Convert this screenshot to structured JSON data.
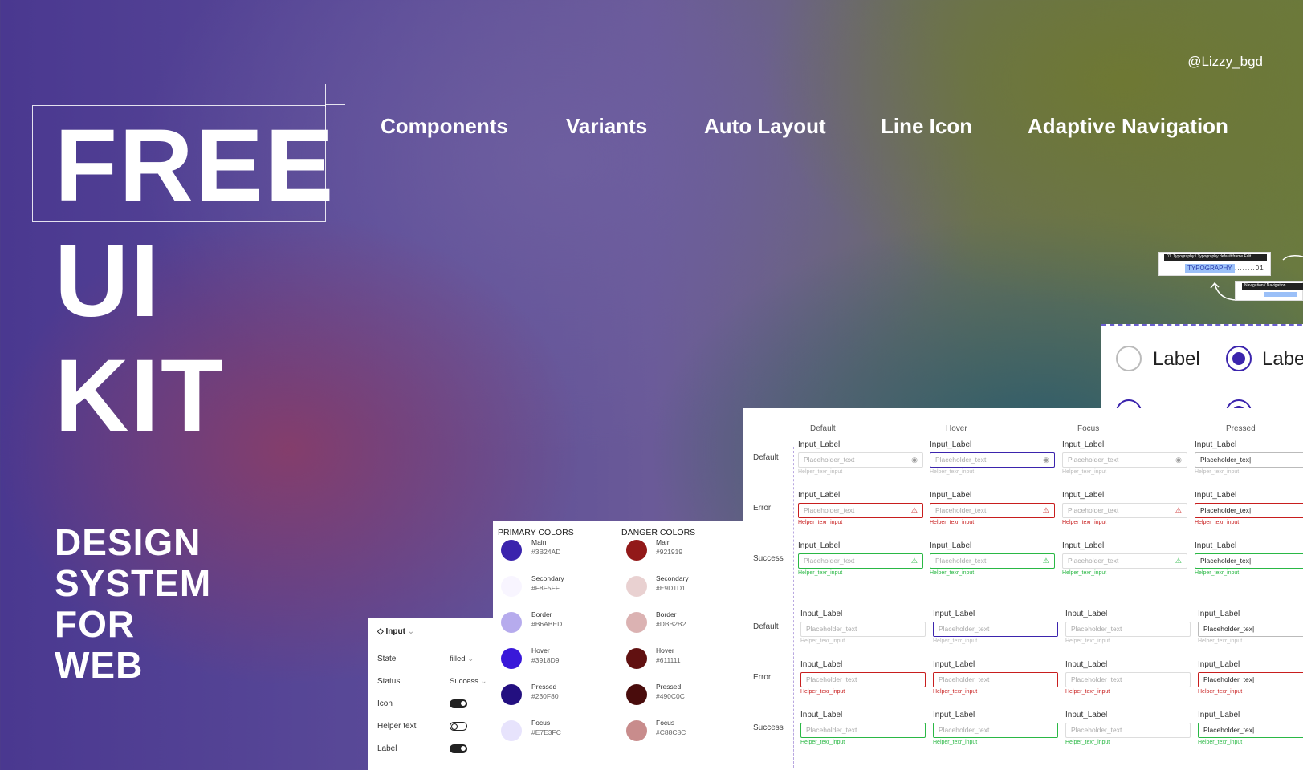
{
  "handle": "@Lizzy_bgd",
  "nav": [
    "Components",
    "Variants",
    "Auto Layout",
    "Line Icon",
    "Adaptive Navigation"
  ],
  "hero": {
    "line1": "FREE",
    "line2": "UI",
    "line3": "KIT"
  },
  "subtitle": [
    "DESIGN",
    "SYSTEM",
    "FOR",
    "WEB"
  ],
  "typography_chip": {
    "header": "01. Typography / Typography  default frame  Edit",
    "tag": "TYPOGRAPHY",
    "dots": "........01"
  },
  "navigation_chip": {
    "header": "Navigation / Navigation"
  },
  "radio": {
    "label": "Label"
  },
  "input_panel": {
    "title": "Input",
    "rows": [
      {
        "label": "State",
        "value": "filled",
        "type": "select"
      },
      {
        "label": "Status",
        "value": "Success",
        "type": "select"
      },
      {
        "label": "Icon",
        "type": "toggle",
        "on": true
      },
      {
        "label": "Helper text",
        "type": "toggle",
        "on": false
      },
      {
        "label": "Label",
        "type": "toggle",
        "on": true
      }
    ]
  },
  "colors": {
    "primary_title": "PRIMARY COLORS",
    "danger_title": "DANGER COLORS",
    "primary": [
      {
        "name": "Main",
        "hex": "#3B24AD"
      },
      {
        "name": "Secondary",
        "hex": "#F8F5FF"
      },
      {
        "name": "Border",
        "hex": "#B6ABED"
      },
      {
        "name": "Hover",
        "hex": "#3918D9"
      },
      {
        "name": "Pressed",
        "hex": "#230F80"
      },
      {
        "name": "Focus",
        "hex": "#E7E3FC"
      }
    ],
    "danger": [
      {
        "name": "Main",
        "hex": "#921919"
      },
      {
        "name": "Secondary",
        "hex": "#E9D1D1"
      },
      {
        "name": "Border",
        "hex": "#DBB2B2"
      },
      {
        "name": "Hover",
        "hex": "#611111"
      },
      {
        "name": "Pressed",
        "hex": "#490C0C"
      },
      {
        "name": "Focus",
        "hex": "#C88C8C"
      }
    ]
  },
  "inputs": {
    "columns": [
      "Default",
      "Hover",
      "Focus",
      "Pressed"
    ],
    "rows": [
      "Default",
      "Error",
      "Success",
      "Default",
      "Error",
      "Success"
    ],
    "label": "Input_Label",
    "placeholder": "Placeholder_text",
    "pressed_value": "Placeholder_tex|",
    "helper": "Helper_texr_input"
  }
}
